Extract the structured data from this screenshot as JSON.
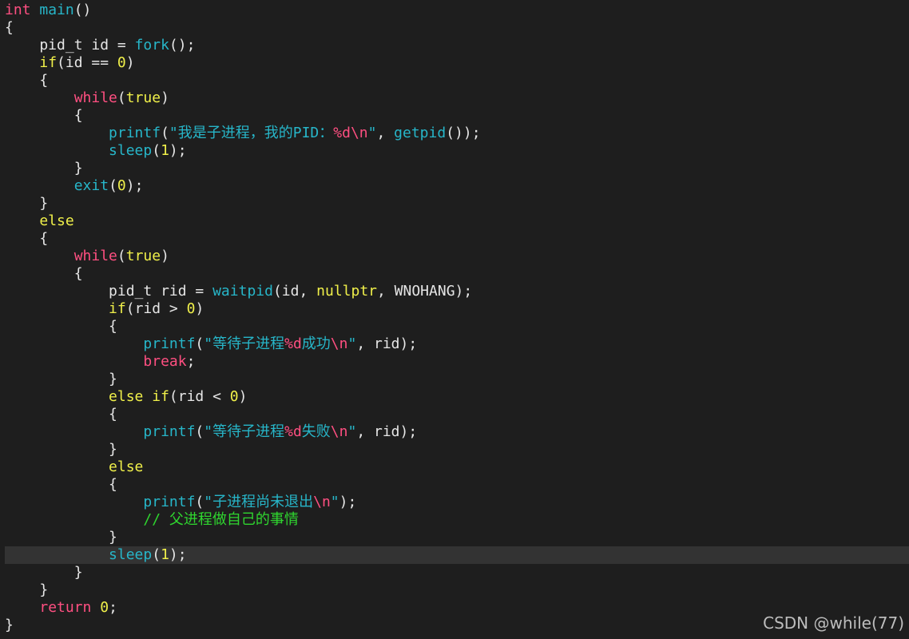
{
  "code_lines": [
    [
      [
        "kw",
        "int"
      ],
      [
        "plain",
        " "
      ],
      [
        "fn",
        "main"
      ],
      [
        "plain",
        "()"
      ]
    ],
    [
      [
        "plain",
        "{"
      ]
    ],
    [
      [
        "plain",
        "    pid_t id = "
      ],
      [
        "fn",
        "fork"
      ],
      [
        "plain",
        "();"
      ]
    ],
    [
      [
        "plain",
        "    "
      ],
      [
        "kwy",
        "if"
      ],
      [
        "plain",
        "(id == "
      ],
      [
        "num",
        "0"
      ],
      [
        "plain",
        ")"
      ]
    ],
    [
      [
        "plain",
        "    {"
      ]
    ],
    [
      [
        "plain",
        "        "
      ],
      [
        "kw",
        "while"
      ],
      [
        "plain",
        "("
      ],
      [
        "kwy",
        "true"
      ],
      [
        "plain",
        ")"
      ]
    ],
    [
      [
        "plain",
        "        {"
      ]
    ],
    [
      [
        "plain",
        "            "
      ],
      [
        "fn",
        "printf"
      ],
      [
        "plain",
        "("
      ],
      [
        "str",
        "\"我是子进程，我的PID："
      ],
      [
        "esc",
        "%d\\n"
      ],
      [
        "str",
        "\""
      ],
      [
        "plain",
        ", "
      ],
      [
        "fn",
        "getpid"
      ],
      [
        "plain",
        "());"
      ]
    ],
    [
      [
        "plain",
        "            "
      ],
      [
        "fn",
        "sleep"
      ],
      [
        "plain",
        "("
      ],
      [
        "num",
        "1"
      ],
      [
        "plain",
        ");"
      ]
    ],
    [
      [
        "plain",
        "        }"
      ]
    ],
    [
      [
        "plain",
        "        "
      ],
      [
        "fn",
        "exit"
      ],
      [
        "plain",
        "("
      ],
      [
        "num",
        "0"
      ],
      [
        "plain",
        ");"
      ]
    ],
    [
      [
        "plain",
        "    }"
      ]
    ],
    [
      [
        "plain",
        "    "
      ],
      [
        "kwy",
        "else"
      ]
    ],
    [
      [
        "plain",
        "    {"
      ]
    ],
    [
      [
        "plain",
        "        "
      ],
      [
        "kw",
        "while"
      ],
      [
        "plain",
        "("
      ],
      [
        "kwy",
        "true"
      ],
      [
        "plain",
        ")"
      ]
    ],
    [
      [
        "plain",
        "        {"
      ]
    ],
    [
      [
        "plain",
        "            pid_t rid = "
      ],
      [
        "fn",
        "waitpid"
      ],
      [
        "plain",
        "(id, "
      ],
      [
        "kwy",
        "nullptr"
      ],
      [
        "plain",
        ", WNOHANG);"
      ]
    ],
    [
      [
        "plain",
        "            "
      ],
      [
        "kwy",
        "if"
      ],
      [
        "plain",
        "(rid > "
      ],
      [
        "num",
        "0"
      ],
      [
        "plain",
        ")"
      ]
    ],
    [
      [
        "plain",
        "            {"
      ]
    ],
    [
      [
        "plain",
        "                "
      ],
      [
        "fn",
        "printf"
      ],
      [
        "plain",
        "("
      ],
      [
        "str",
        "\"等待子进程"
      ],
      [
        "esc",
        "%d"
      ],
      [
        "str",
        "成功"
      ],
      [
        "esc",
        "\\n"
      ],
      [
        "str",
        "\""
      ],
      [
        "plain",
        ", rid);"
      ]
    ],
    [
      [
        "plain",
        "                "
      ],
      [
        "kw",
        "break"
      ],
      [
        "plain",
        ";"
      ]
    ],
    [
      [
        "plain",
        "            }"
      ]
    ],
    [
      [
        "plain",
        "            "
      ],
      [
        "kwy",
        "else if"
      ],
      [
        "plain",
        "(rid < "
      ],
      [
        "num",
        "0"
      ],
      [
        "plain",
        ")"
      ]
    ],
    [
      [
        "plain",
        "            {"
      ]
    ],
    [
      [
        "plain",
        "                "
      ],
      [
        "fn",
        "printf"
      ],
      [
        "plain",
        "("
      ],
      [
        "str",
        "\"等待子进程"
      ],
      [
        "esc",
        "%d"
      ],
      [
        "str",
        "失败"
      ],
      [
        "esc",
        "\\n"
      ],
      [
        "str",
        "\""
      ],
      [
        "plain",
        ", rid);"
      ]
    ],
    [
      [
        "plain",
        "            }"
      ]
    ],
    [
      [
        "plain",
        "            "
      ],
      [
        "kwy",
        "else"
      ]
    ],
    [
      [
        "plain",
        "            {"
      ]
    ],
    [
      [
        "plain",
        "                "
      ],
      [
        "fn",
        "printf"
      ],
      [
        "plain",
        "("
      ],
      [
        "str",
        "\"子进程尚未退出"
      ],
      [
        "esc",
        "\\n"
      ],
      [
        "str",
        "\""
      ],
      [
        "plain",
        ");"
      ]
    ],
    [
      [
        "plain",
        "                "
      ],
      [
        "cmt",
        "// 父进程做自己的事情"
      ]
    ],
    [
      [
        "plain",
        "            }"
      ]
    ],
    [
      [
        "plain",
        "            "
      ],
      [
        "fn",
        "sleep"
      ],
      [
        "plain",
        "("
      ],
      [
        "num",
        "1"
      ],
      [
        "plain",
        ");"
      ]
    ],
    [
      [
        "plain",
        "        }"
      ]
    ],
    [
      [
        "plain",
        "    }"
      ]
    ],
    [
      [
        "plain",
        "    "
      ],
      [
        "kw",
        "return"
      ],
      [
        "plain",
        " "
      ],
      [
        "num",
        "0"
      ],
      [
        "plain",
        ";"
      ]
    ],
    [
      [
        "plain",
        "}"
      ]
    ]
  ],
  "current_line_index": 31,
  "watermark": "CSDN @while(77)",
  "colors": {
    "background": "#1e1e1e",
    "current_line": "#333333",
    "keyword_pink": "#ff4f81",
    "function_cyan": "#27b6c9",
    "keyword_yellow": "#f0f04a",
    "comment_green": "#2fd62f",
    "plain_text": "#e6e6e6"
  }
}
